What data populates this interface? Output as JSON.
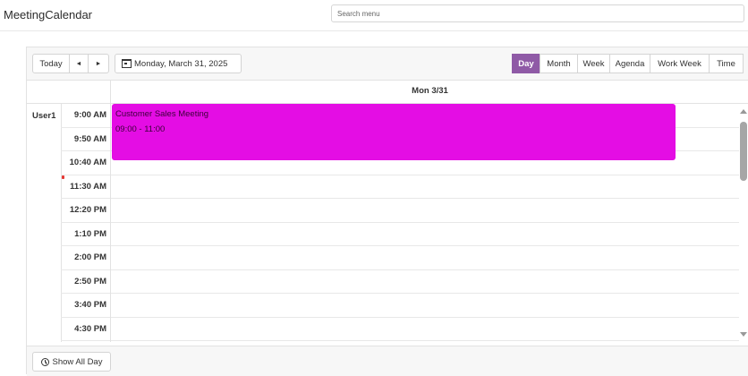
{
  "app": {
    "title": "MeetingCalendar"
  },
  "search": {
    "placeholder": "Search menu"
  },
  "toolbar": {
    "today_label": "Today",
    "prev_glyph": "◄",
    "next_glyph": "►",
    "date_label": "Monday, March 31, 2025",
    "views": [
      "Day",
      "Month",
      "Week",
      "Agenda",
      "Work Week",
      "Time"
    ],
    "active_view": "Day"
  },
  "day_header": "Mon 3/31",
  "resource": "User1",
  "time_slots": [
    "9:00 AM",
    "9:50 AM",
    "10:40 AM",
    "11:30 AM",
    "12:20 PM",
    "1:10 PM",
    "2:00 PM",
    "2:50 PM",
    "3:40 PM",
    "4:30 PM"
  ],
  "appointment": {
    "title": "Customer Sales Meeting",
    "time": "09:00 - 11:00",
    "color": "#e40de4"
  },
  "footer": {
    "show_all_day_label": "Show All Day"
  },
  "colors": {
    "accent": "#8f5aa6",
    "now_indicator": "#e53935"
  }
}
